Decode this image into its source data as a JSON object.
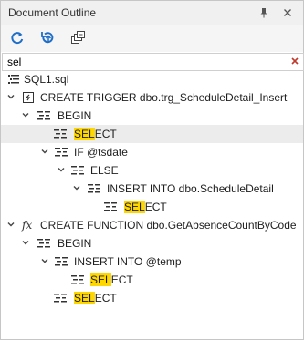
{
  "panel": {
    "title": "Document Outline",
    "pin_icon": "pin-icon",
    "close_icon": "close-icon"
  },
  "toolbar": {
    "refresh_icon": "refresh-icon",
    "refresh_sync_icon": "refresh-sync-icon",
    "collapse_all_icon": "collapse-all-icon"
  },
  "search": {
    "value": "sel",
    "clear_icon": "clear-x-icon"
  },
  "tree": {
    "highlight_color": "#ffd700",
    "items": [
      {
        "label": "SQL1.sql"
      },
      {
        "label": "CREATE TRIGGER dbo.trg_ScheduleDetail_Insert"
      },
      {
        "label": "BEGIN"
      },
      {
        "pre": "",
        "match": "SEL",
        "post": "ECT"
      },
      {
        "label": "IF @tsdate"
      },
      {
        "label": "ELSE"
      },
      {
        "label": "INSERT INTO dbo.ScheduleDetail"
      },
      {
        "pre": "",
        "match": "SEL",
        "post": "ECT"
      },
      {
        "label": "CREATE FUNCTION dbo.GetAbsenceCountByCode"
      },
      {
        "label": "BEGIN"
      },
      {
        "label": "INSERT INTO @temp"
      },
      {
        "pre": "",
        "match": "SEL",
        "post": "ECT"
      },
      {
        "pre": "",
        "match": "SEL",
        "post": "ECT"
      }
    ]
  }
}
